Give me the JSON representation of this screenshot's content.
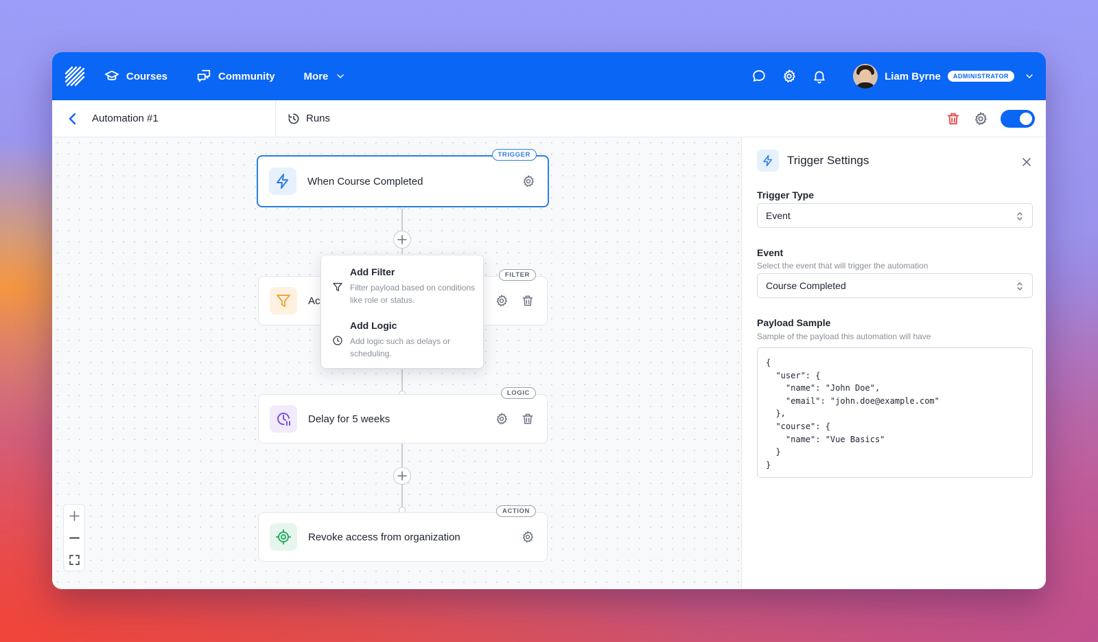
{
  "nav": {
    "courses": "Courses",
    "community": "Community",
    "more": "More",
    "user_name": "Liam Byrne",
    "user_role": "ADMINISTRATOR"
  },
  "subheader": {
    "title": "Automation #1",
    "runs": "Runs",
    "enabled": true
  },
  "flow": {
    "trigger": {
      "tag": "TRIGGER",
      "title": "When Course Completed"
    },
    "filter": {
      "tag": "FILTER",
      "title": "Ac"
    },
    "logic": {
      "tag": "LOGIC",
      "title": "Delay for 5 weeks"
    },
    "action": {
      "tag": "ACTION",
      "title": "Revoke access from organization"
    }
  },
  "add_menu": {
    "items": [
      {
        "title": "Add Filter",
        "desc": "Filter payload based on conditions like role or status."
      },
      {
        "title": "Add Logic",
        "desc": "Add logic such as delays or scheduling."
      }
    ]
  },
  "panel": {
    "title": "Trigger Settings",
    "trigger_type_label": "Trigger Type",
    "trigger_type_value": "Event",
    "event_label": "Event",
    "event_hint": "Select the event that will trigger the automation",
    "event_value": "Course Completed",
    "payload_label": "Payload Sample",
    "payload_hint": "Sample of the payload this automation will have",
    "payload_code": "{\n  \"user\": {\n    \"name\": \"John Doe\",\n    \"email\": \"john.doe@example.com\"\n  },\n  \"course\": {\n    \"name\": \"Vue Basics\"\n  }\n}"
  },
  "colors": {
    "brand": "#0a66f5",
    "trigger": "#2a7de9",
    "filter": "#f5a23a",
    "logic": "#7c4fe0",
    "action": "#27ae60",
    "danger": "#e5484d"
  }
}
